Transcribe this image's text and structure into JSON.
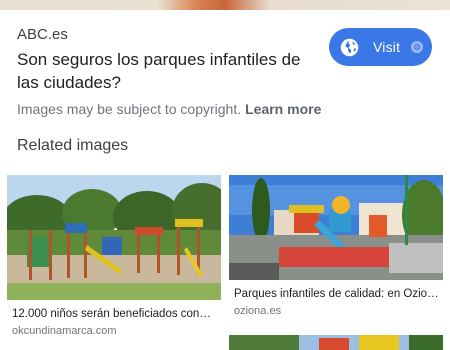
{
  "result": {
    "source": "ABC.es",
    "title": "Son seguros los parques infantiles de las ciudades?",
    "visit_label": "Visit",
    "copyright_text": "Images may be subject to copyright.",
    "learn_more": "Learn more"
  },
  "related": {
    "heading": "Related images",
    "items": [
      {
        "caption": "12.000 niños serán beneficiados con l...",
        "domain": "okcundinamarca.com"
      },
      {
        "caption": "Parques infantiles de calidad: en Ozion...",
        "domain": "oziona.es"
      },
      {
        "caption": "",
        "domain": ""
      }
    ]
  },
  "colors": {
    "accent": "#3b78e7",
    "text": "#202124",
    "muted": "#70757a"
  }
}
